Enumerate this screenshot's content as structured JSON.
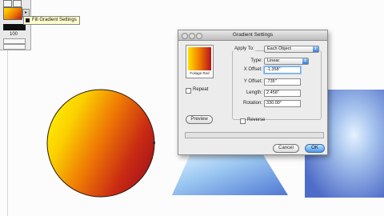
{
  "tooltip": {
    "text": "Fill Gradient Settings"
  },
  "toolbox": {
    "field_value": "100"
  },
  "dialog": {
    "title": "Gradient Settings",
    "preview_label": "Foliage Red",
    "repeat_label": "Repeat",
    "preview_button": "Preview",
    "apply_to": {
      "label": "Apply To:",
      "value": "Each Object"
    },
    "type": {
      "label": "Type:",
      "value": "Linear"
    },
    "x_offset": {
      "label": "X Offset:",
      "value": "-1.358\""
    },
    "y_offset": {
      "label": "Y Offset:",
      "value": ".735\""
    },
    "length": {
      "label": "Length:",
      "value": "2.458\""
    },
    "rotation": {
      "label": "Rotation:",
      "value": "330.00°"
    },
    "reverse_label": "Reverse",
    "cancel_button": "Cancel",
    "ok_button": "OK"
  },
  "colors": {
    "gradient_start": "#ffe600",
    "gradient_mid": "#f07a00",
    "gradient_end": "#b5121b",
    "blue_light": "#c9dcf5",
    "blue_dark": "#5470c8"
  }
}
